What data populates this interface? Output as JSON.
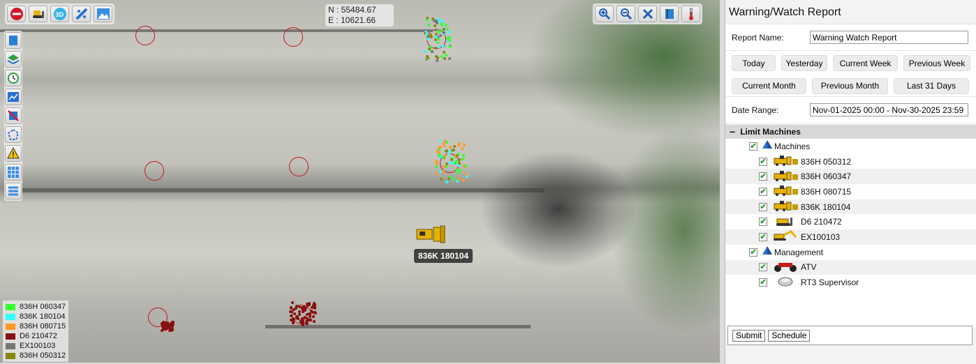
{
  "map": {
    "coords": {
      "north": "N : 55484.67",
      "east": "E : 10621.66"
    },
    "machine_label": "836K 180104",
    "toolbar_left": [
      "stop-icon",
      "dozer-icon",
      "3d-icon",
      "ruler-icon",
      "image-icon"
    ],
    "toolbar_right": [
      "zoom-in-icon",
      "zoom-out-icon",
      "zoom-extent-icon",
      "book-icon",
      "thermometer-icon"
    ],
    "side_tools": [
      "map-icon",
      "layers-icon",
      "history-icon",
      "chart-icon",
      "disable-icon",
      "polygon-icon",
      "warning-icon",
      "grid-icon",
      "list-icon"
    ],
    "legend": [
      {
        "name": "836H 060347",
        "color": "#33ff33"
      },
      {
        "name": "836K 180104",
        "color": "#33ffff"
      },
      {
        "name": "836H 080715",
        "color": "#ff9922"
      },
      {
        "name": "D6 210472",
        "color": "#881111"
      },
      {
        "name": "EX100103",
        "color": "#777777"
      },
      {
        "name": "836H 050312",
        "color": "#888811"
      }
    ]
  },
  "panel": {
    "title": "Warning/Watch Report",
    "report_name_label": "Report Name:",
    "report_name_value": "Warning Watch Report",
    "date_buttons_row1": [
      "Today",
      "Yesterday",
      "Current Week",
      "Previous Week"
    ],
    "date_buttons_row2": [
      "Current Month",
      "Previous Month",
      "Last 31 Days"
    ],
    "date_range_label": "Date Range:",
    "date_range_value": "Nov-01-2025 00:00 - Nov-30-2025 23:59",
    "limit_section": "Limit Machines",
    "machines_group": "Machines",
    "machines": [
      "836H 050312",
      "836H 060347",
      "836H 080715",
      "836K 180104",
      "D6 210472",
      "EX100103"
    ],
    "management_group": "Management",
    "management": [
      "ATV",
      "RT3 Supervisor"
    ],
    "submit": "Submit",
    "schedule": "Schedule"
  }
}
